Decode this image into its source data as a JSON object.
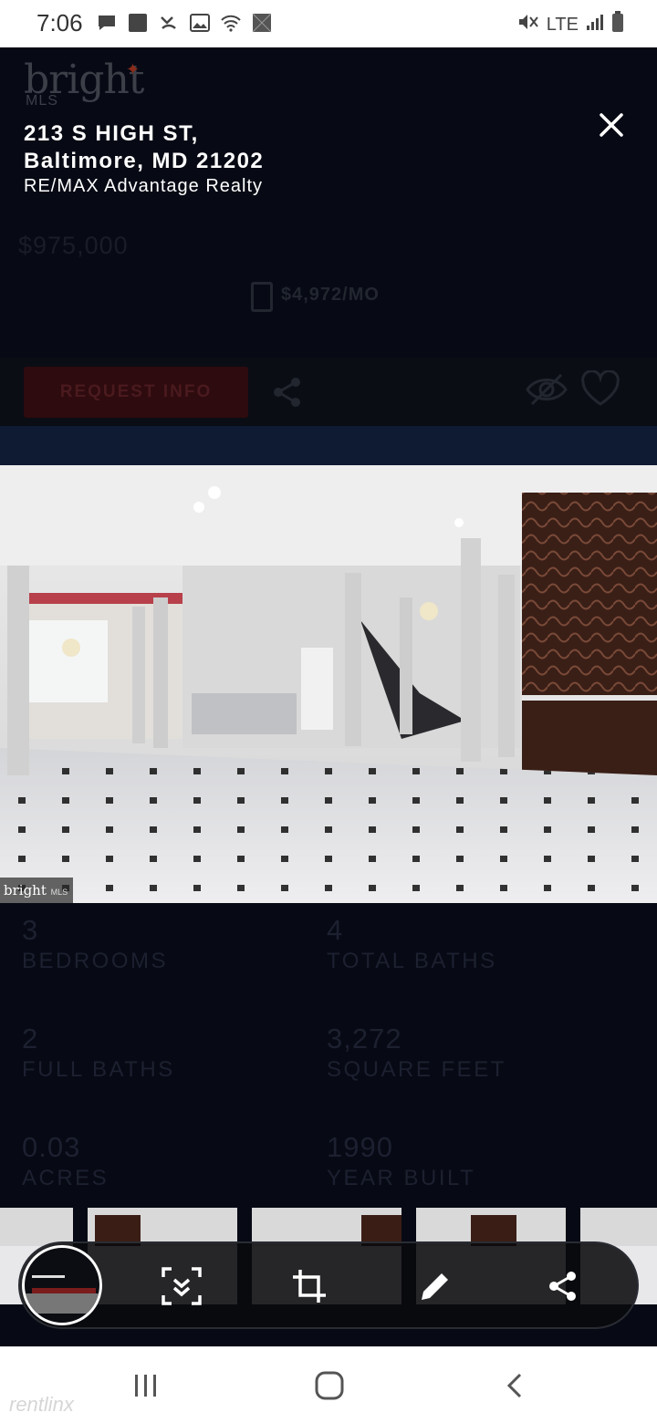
{
  "status_bar": {
    "time": "7:06",
    "network": "LTE",
    "icons": [
      "message-icon",
      "square-app-icon",
      "missed-call-icon",
      "image-icon",
      "wifi-icon",
      "photo-icon",
      "mute-icon",
      "signal-icon",
      "battery-icon"
    ]
  },
  "background_page": {
    "logo": "bright",
    "logo_sub": "MLS",
    "price": "$975,000",
    "monthly": "$4,972/MO",
    "request_button": "REQUEST INFO"
  },
  "header": {
    "title_line1": "213 S HIGH ST,",
    "title_line2": "Baltimore, MD 21202",
    "brokerage": "RE/MAX Advantage Realty"
  },
  "photo": {
    "watermark_brand": "bright",
    "watermark_sub": "MLS"
  },
  "stats": [
    {
      "value": "3",
      "label": "BEDROOMS"
    },
    {
      "value": "4",
      "label": "TOTAL BATHS"
    },
    {
      "value": "2",
      "label": "FULL BATHS"
    },
    {
      "value": "3,272",
      "label": "SQUARE FEET"
    },
    {
      "value": "0.03",
      "label": "ACRES"
    },
    {
      "value": "1990",
      "label": "YEAR BUILT"
    }
  ],
  "toolbar": {
    "actions": [
      "scroll-capture",
      "crop",
      "draw",
      "share"
    ]
  },
  "navbar": {
    "buttons": [
      "recent-apps",
      "home",
      "back"
    ],
    "watermark": "rentlinx"
  },
  "colors": {
    "overlay_bg": "#070a14",
    "accent_red": "#8a2b1a",
    "white": "#ffffff"
  }
}
